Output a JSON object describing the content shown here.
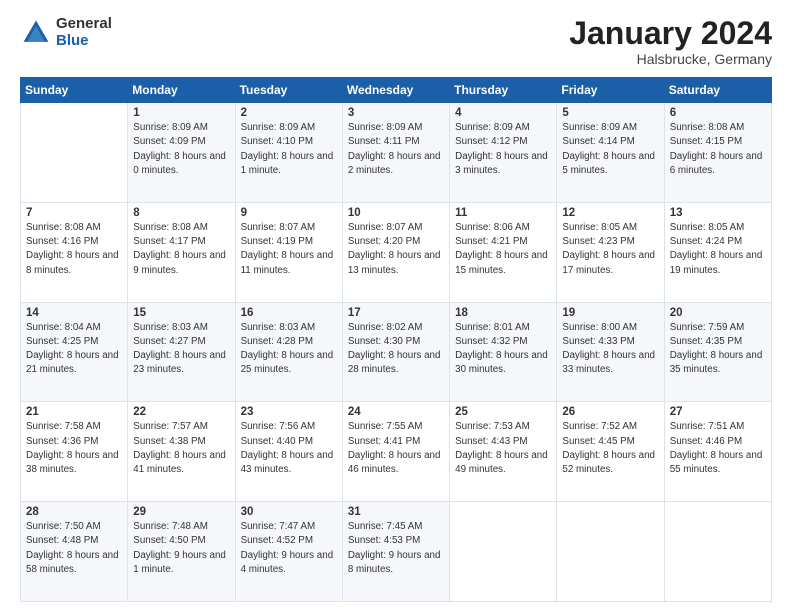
{
  "logo": {
    "general": "General",
    "blue": "Blue"
  },
  "header": {
    "month": "January 2024",
    "location": "Halsbrucke, Germany"
  },
  "weekdays": [
    "Sunday",
    "Monday",
    "Tuesday",
    "Wednesday",
    "Thursday",
    "Friday",
    "Saturday"
  ],
  "weeks": [
    [
      {
        "day": "",
        "sunrise": "",
        "sunset": "",
        "daylight": ""
      },
      {
        "day": "1",
        "sunrise": "Sunrise: 8:09 AM",
        "sunset": "Sunset: 4:09 PM",
        "daylight": "Daylight: 8 hours and 0 minutes."
      },
      {
        "day": "2",
        "sunrise": "Sunrise: 8:09 AM",
        "sunset": "Sunset: 4:10 PM",
        "daylight": "Daylight: 8 hours and 1 minute."
      },
      {
        "day": "3",
        "sunrise": "Sunrise: 8:09 AM",
        "sunset": "Sunset: 4:11 PM",
        "daylight": "Daylight: 8 hours and 2 minutes."
      },
      {
        "day": "4",
        "sunrise": "Sunrise: 8:09 AM",
        "sunset": "Sunset: 4:12 PM",
        "daylight": "Daylight: 8 hours and 3 minutes."
      },
      {
        "day": "5",
        "sunrise": "Sunrise: 8:09 AM",
        "sunset": "Sunset: 4:14 PM",
        "daylight": "Daylight: 8 hours and 5 minutes."
      },
      {
        "day": "6",
        "sunrise": "Sunrise: 8:08 AM",
        "sunset": "Sunset: 4:15 PM",
        "daylight": "Daylight: 8 hours and 6 minutes."
      }
    ],
    [
      {
        "day": "7",
        "sunrise": "Sunrise: 8:08 AM",
        "sunset": "Sunset: 4:16 PM",
        "daylight": "Daylight: 8 hours and 8 minutes."
      },
      {
        "day": "8",
        "sunrise": "Sunrise: 8:08 AM",
        "sunset": "Sunset: 4:17 PM",
        "daylight": "Daylight: 8 hours and 9 minutes."
      },
      {
        "day": "9",
        "sunrise": "Sunrise: 8:07 AM",
        "sunset": "Sunset: 4:19 PM",
        "daylight": "Daylight: 8 hours and 11 minutes."
      },
      {
        "day": "10",
        "sunrise": "Sunrise: 8:07 AM",
        "sunset": "Sunset: 4:20 PM",
        "daylight": "Daylight: 8 hours and 13 minutes."
      },
      {
        "day": "11",
        "sunrise": "Sunrise: 8:06 AM",
        "sunset": "Sunset: 4:21 PM",
        "daylight": "Daylight: 8 hours and 15 minutes."
      },
      {
        "day": "12",
        "sunrise": "Sunrise: 8:05 AM",
        "sunset": "Sunset: 4:23 PM",
        "daylight": "Daylight: 8 hours and 17 minutes."
      },
      {
        "day": "13",
        "sunrise": "Sunrise: 8:05 AM",
        "sunset": "Sunset: 4:24 PM",
        "daylight": "Daylight: 8 hours and 19 minutes."
      }
    ],
    [
      {
        "day": "14",
        "sunrise": "Sunrise: 8:04 AM",
        "sunset": "Sunset: 4:25 PM",
        "daylight": "Daylight: 8 hours and 21 minutes."
      },
      {
        "day": "15",
        "sunrise": "Sunrise: 8:03 AM",
        "sunset": "Sunset: 4:27 PM",
        "daylight": "Daylight: 8 hours and 23 minutes."
      },
      {
        "day": "16",
        "sunrise": "Sunrise: 8:03 AM",
        "sunset": "Sunset: 4:28 PM",
        "daylight": "Daylight: 8 hours and 25 minutes."
      },
      {
        "day": "17",
        "sunrise": "Sunrise: 8:02 AM",
        "sunset": "Sunset: 4:30 PM",
        "daylight": "Daylight: 8 hours and 28 minutes."
      },
      {
        "day": "18",
        "sunrise": "Sunrise: 8:01 AM",
        "sunset": "Sunset: 4:32 PM",
        "daylight": "Daylight: 8 hours and 30 minutes."
      },
      {
        "day": "19",
        "sunrise": "Sunrise: 8:00 AM",
        "sunset": "Sunset: 4:33 PM",
        "daylight": "Daylight: 8 hours and 33 minutes."
      },
      {
        "day": "20",
        "sunrise": "Sunrise: 7:59 AM",
        "sunset": "Sunset: 4:35 PM",
        "daylight": "Daylight: 8 hours and 35 minutes."
      }
    ],
    [
      {
        "day": "21",
        "sunrise": "Sunrise: 7:58 AM",
        "sunset": "Sunset: 4:36 PM",
        "daylight": "Daylight: 8 hours and 38 minutes."
      },
      {
        "day": "22",
        "sunrise": "Sunrise: 7:57 AM",
        "sunset": "Sunset: 4:38 PM",
        "daylight": "Daylight: 8 hours and 41 minutes."
      },
      {
        "day": "23",
        "sunrise": "Sunrise: 7:56 AM",
        "sunset": "Sunset: 4:40 PM",
        "daylight": "Daylight: 8 hours and 43 minutes."
      },
      {
        "day": "24",
        "sunrise": "Sunrise: 7:55 AM",
        "sunset": "Sunset: 4:41 PM",
        "daylight": "Daylight: 8 hours and 46 minutes."
      },
      {
        "day": "25",
        "sunrise": "Sunrise: 7:53 AM",
        "sunset": "Sunset: 4:43 PM",
        "daylight": "Daylight: 8 hours and 49 minutes."
      },
      {
        "day": "26",
        "sunrise": "Sunrise: 7:52 AM",
        "sunset": "Sunset: 4:45 PM",
        "daylight": "Daylight: 8 hours and 52 minutes."
      },
      {
        "day": "27",
        "sunrise": "Sunrise: 7:51 AM",
        "sunset": "Sunset: 4:46 PM",
        "daylight": "Daylight: 8 hours and 55 minutes."
      }
    ],
    [
      {
        "day": "28",
        "sunrise": "Sunrise: 7:50 AM",
        "sunset": "Sunset: 4:48 PM",
        "daylight": "Daylight: 8 hours and 58 minutes."
      },
      {
        "day": "29",
        "sunrise": "Sunrise: 7:48 AM",
        "sunset": "Sunset: 4:50 PM",
        "daylight": "Daylight: 9 hours and 1 minute."
      },
      {
        "day": "30",
        "sunrise": "Sunrise: 7:47 AM",
        "sunset": "Sunset: 4:52 PM",
        "daylight": "Daylight: 9 hours and 4 minutes."
      },
      {
        "day": "31",
        "sunrise": "Sunrise: 7:45 AM",
        "sunset": "Sunset: 4:53 PM",
        "daylight": "Daylight: 9 hours and 8 minutes."
      },
      {
        "day": "",
        "sunrise": "",
        "sunset": "",
        "daylight": ""
      },
      {
        "day": "",
        "sunrise": "",
        "sunset": "",
        "daylight": ""
      },
      {
        "day": "",
        "sunrise": "",
        "sunset": "",
        "daylight": ""
      }
    ]
  ]
}
